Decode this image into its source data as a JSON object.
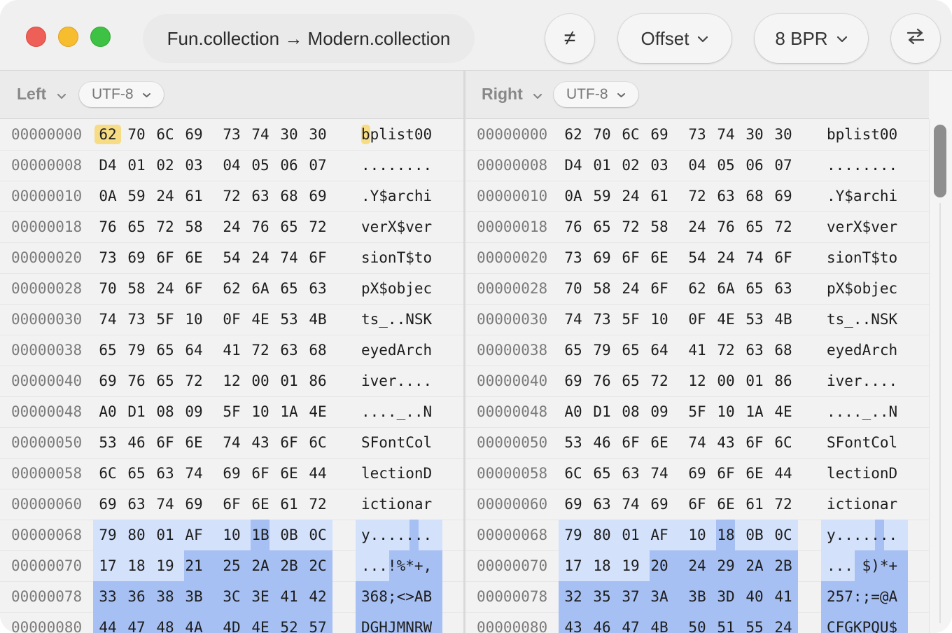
{
  "titlebar": {
    "title": "Fun.collection → Modern.collection",
    "diff_label": "≠",
    "offset_label": "Offset",
    "bpr_label": "8 BPR",
    "swap_label": "⇆",
    "chevron": "⌄"
  },
  "left": {
    "label": "Left",
    "encoding": "UTF-8",
    "rows": [
      {
        "offset": "00000000",
        "bytes": [
          "62",
          "70",
          "6C",
          "69",
          "73",
          "74",
          "30",
          "30"
        ],
        "ascii": "bplist00"
      },
      {
        "offset": "00000008",
        "bytes": [
          "D4",
          "01",
          "02",
          "03",
          "04",
          "05",
          "06",
          "07"
        ],
        "ascii": "........"
      },
      {
        "offset": "00000010",
        "bytes": [
          "0A",
          "59",
          "24",
          "61",
          "72",
          "63",
          "68",
          "69"
        ],
        "ascii": ".Y$archi"
      },
      {
        "offset": "00000018",
        "bytes": [
          "76",
          "65",
          "72",
          "58",
          "24",
          "76",
          "65",
          "72"
        ],
        "ascii": "verX$ver"
      },
      {
        "offset": "00000020",
        "bytes": [
          "73",
          "69",
          "6F",
          "6E",
          "54",
          "24",
          "74",
          "6F"
        ],
        "ascii": "sionT$to"
      },
      {
        "offset": "00000028",
        "bytes": [
          "70",
          "58",
          "24",
          "6F",
          "62",
          "6A",
          "65",
          "63"
        ],
        "ascii": "pX$objec"
      },
      {
        "offset": "00000030",
        "bytes": [
          "74",
          "73",
          "5F",
          "10",
          "0F",
          "4E",
          "53",
          "4B"
        ],
        "ascii": "ts_..NSK"
      },
      {
        "offset": "00000038",
        "bytes": [
          "65",
          "79",
          "65",
          "64",
          "41",
          "72",
          "63",
          "68"
        ],
        "ascii": "eyedArch"
      },
      {
        "offset": "00000040",
        "bytes": [
          "69",
          "76",
          "65",
          "72",
          "12",
          "00",
          "01",
          "86"
        ],
        "ascii": "iver...."
      },
      {
        "offset": "00000048",
        "bytes": [
          "A0",
          "D1",
          "08",
          "09",
          "5F",
          "10",
          "1A",
          "4E"
        ],
        "ascii": "...._..N"
      },
      {
        "offset": "00000050",
        "bytes": [
          "53",
          "46",
          "6F",
          "6E",
          "74",
          "43",
          "6F",
          "6C"
        ],
        "ascii": "SFontCol"
      },
      {
        "offset": "00000058",
        "bytes": [
          "6C",
          "65",
          "63",
          "74",
          "69",
          "6F",
          "6E",
          "44"
        ],
        "ascii": "lectionD"
      },
      {
        "offset": "00000060",
        "bytes": [
          "69",
          "63",
          "74",
          "69",
          "6F",
          "6E",
          "61",
          "72"
        ],
        "ascii": "ictionar"
      },
      {
        "offset": "00000068",
        "bytes": [
          "79",
          "80",
          "01",
          "AF",
          "10",
          "1B",
          "0B",
          "0C"
        ],
        "ascii": "y......."
      },
      {
        "offset": "00000070",
        "bytes": [
          "17",
          "18",
          "19",
          "21",
          "25",
          "2A",
          "2B",
          "2C"
        ],
        "ascii": "...!%*+,"
      },
      {
        "offset": "00000078",
        "bytes": [
          "33",
          "36",
          "38",
          "3B",
          "3C",
          "3E",
          "41",
          "42"
        ],
        "ascii": "368;<>AB"
      },
      {
        "offset": "00000080",
        "bytes": [
          "44",
          "47",
          "48",
          "4A",
          "4D",
          "4E",
          "52",
          "57"
        ],
        "ascii": "DGHJMNRW"
      }
    ]
  },
  "right": {
    "label": "Right",
    "encoding": "UTF-8",
    "rows": [
      {
        "offset": "00000000",
        "bytes": [
          "62",
          "70",
          "6C",
          "69",
          "73",
          "74",
          "30",
          "30"
        ],
        "ascii": "bplist00"
      },
      {
        "offset": "00000008",
        "bytes": [
          "D4",
          "01",
          "02",
          "03",
          "04",
          "05",
          "06",
          "07"
        ],
        "ascii": "........"
      },
      {
        "offset": "00000010",
        "bytes": [
          "0A",
          "59",
          "24",
          "61",
          "72",
          "63",
          "68",
          "69"
        ],
        "ascii": ".Y$archi"
      },
      {
        "offset": "00000018",
        "bytes": [
          "76",
          "65",
          "72",
          "58",
          "24",
          "76",
          "65",
          "72"
        ],
        "ascii": "verX$ver"
      },
      {
        "offset": "00000020",
        "bytes": [
          "73",
          "69",
          "6F",
          "6E",
          "54",
          "24",
          "74",
          "6F"
        ],
        "ascii": "sionT$to"
      },
      {
        "offset": "00000028",
        "bytes": [
          "70",
          "58",
          "24",
          "6F",
          "62",
          "6A",
          "65",
          "63"
        ],
        "ascii": "pX$objec"
      },
      {
        "offset": "00000030",
        "bytes": [
          "74",
          "73",
          "5F",
          "10",
          "0F",
          "4E",
          "53",
          "4B"
        ],
        "ascii": "ts_..NSK"
      },
      {
        "offset": "00000038",
        "bytes": [
          "65",
          "79",
          "65",
          "64",
          "41",
          "72",
          "63",
          "68"
        ],
        "ascii": "eyedArch"
      },
      {
        "offset": "00000040",
        "bytes": [
          "69",
          "76",
          "65",
          "72",
          "12",
          "00",
          "01",
          "86"
        ],
        "ascii": "iver...."
      },
      {
        "offset": "00000048",
        "bytes": [
          "A0",
          "D1",
          "08",
          "09",
          "5F",
          "10",
          "1A",
          "4E"
        ],
        "ascii": "...._..N"
      },
      {
        "offset": "00000050",
        "bytes": [
          "53",
          "46",
          "6F",
          "6E",
          "74",
          "43",
          "6F",
          "6C"
        ],
        "ascii": "SFontCol"
      },
      {
        "offset": "00000058",
        "bytes": [
          "6C",
          "65",
          "63",
          "74",
          "69",
          "6F",
          "6E",
          "44"
        ],
        "ascii": "lectionD"
      },
      {
        "offset": "00000060",
        "bytes": [
          "69",
          "63",
          "74",
          "69",
          "6F",
          "6E",
          "61",
          "72"
        ],
        "ascii": "ictionar"
      },
      {
        "offset": "00000068",
        "bytes": [
          "79",
          "80",
          "01",
          "AF",
          "10",
          "18",
          "0B",
          "0C"
        ],
        "ascii": "y......."
      },
      {
        "offset": "00000070",
        "bytes": [
          "17",
          "18",
          "19",
          "20",
          "24",
          "29",
          "2A",
          "2B"
        ],
        "ascii": "... $)*+"
      },
      {
        "offset": "00000078",
        "bytes": [
          "32",
          "35",
          "37",
          "3A",
          "3B",
          "3D",
          "40",
          "41"
        ],
        "ascii": "257:;=@A"
      },
      {
        "offset": "00000080",
        "bytes": [
          "43",
          "46",
          "47",
          "4B",
          "50",
          "51",
          "55",
          "24"
        ],
        "ascii": "CFGKPQU$"
      }
    ]
  },
  "colors": {
    "cursor_highlight": "#f7dc86",
    "diff_light": "#d3e1fb",
    "diff_strong": "#a7c0f3"
  }
}
